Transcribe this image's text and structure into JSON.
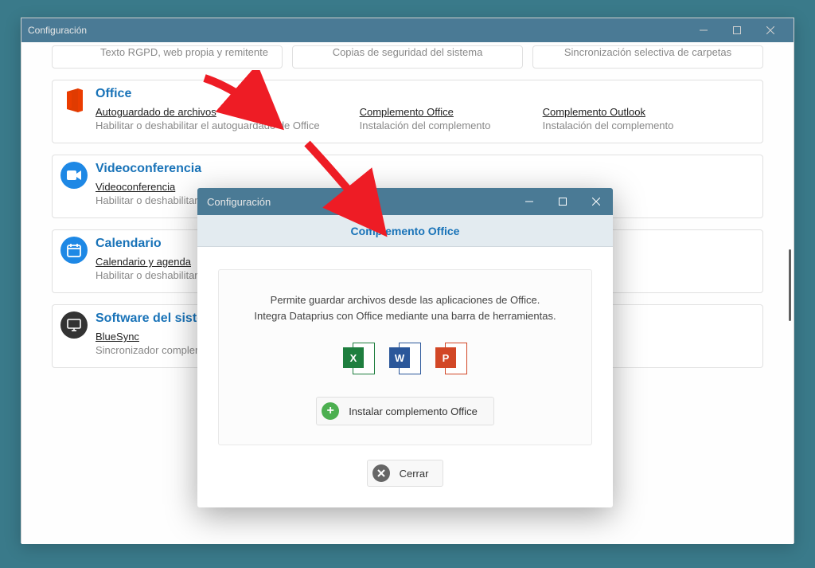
{
  "app": {
    "title": "Configuración"
  },
  "stubs": {
    "a": "Texto RGPD, web propia y remitente",
    "b": "Copias de seguridad del sistema",
    "c": "Sincronización selectiva de carpetas"
  },
  "office": {
    "title": "Office",
    "items": [
      {
        "title": "Autoguardado de archivos",
        "desc": "Habilitar o deshabilitar el autoguardado de Office"
      },
      {
        "title": "Complemento Office",
        "desc": "Instalación del complemento"
      },
      {
        "title": "Complemento Outlook",
        "desc": "Instalación del complemento"
      }
    ]
  },
  "video": {
    "title": "Videoconferencia",
    "item": {
      "title": "Videoconferencia",
      "desc": "Habilitar o deshabilitar videoconferencia"
    }
  },
  "calendar": {
    "title": "Calendario",
    "item": {
      "title": "Calendario y agenda",
      "desc": "Habilitar o deshabilitar Ca"
    }
  },
  "software": {
    "title": "Software del sistema",
    "item": {
      "title": "BlueSync",
      "desc": "Sincronizador compleme  selectivo"
    }
  },
  "dialog": {
    "winTitle": "Configuración",
    "header": "Complemento Office",
    "desc1": "Permite guardar archivos desde las aplicaciones de Office.",
    "desc2": "Integra Dataprius con Office mediante una barra de herramientas.",
    "install": "Instalar complemento Office",
    "close": "Cerrar",
    "icons": {
      "excel": "X",
      "word": "W",
      "ppt": "P"
    }
  }
}
